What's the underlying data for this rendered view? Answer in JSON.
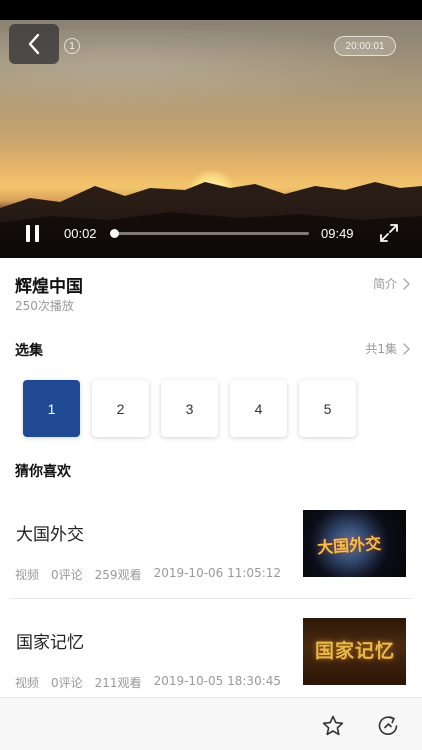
{
  "player": {
    "channel_badge": "1",
    "clock_badge": "20:00:01",
    "current_time": "00:02",
    "total_time": "09:49",
    "progress": 0.003
  },
  "program": {
    "title": "辉煌中国",
    "play_count": "250次播放",
    "intro_label": "简介"
  },
  "episodes": {
    "section_label": "选集",
    "total_label": "共1集",
    "items": [
      "1",
      "2",
      "3",
      "4",
      "5"
    ],
    "selected": "1"
  },
  "recommend": {
    "section_label": "猜你喜欢",
    "items": [
      {
        "title": "大国外交",
        "type": "视频",
        "comments": "0评论",
        "views": "259观看",
        "date": "2019-10-06 11:05:12",
        "thumb_text": "大国外交"
      },
      {
        "title": "国家记忆",
        "type": "视频",
        "comments": "0评论",
        "views": "211观看",
        "date": "2019-10-05 18:30:45",
        "thumb_text": "国家记忆"
      }
    ]
  },
  "icons": {
    "back": "chevron-left-icon",
    "pause": "pause-icon",
    "fullscreen": "expand-icon",
    "favorite": "star-icon",
    "share": "share-icon"
  },
  "colors": {
    "accent": "#1f4a93",
    "muted_text": "#999999"
  }
}
